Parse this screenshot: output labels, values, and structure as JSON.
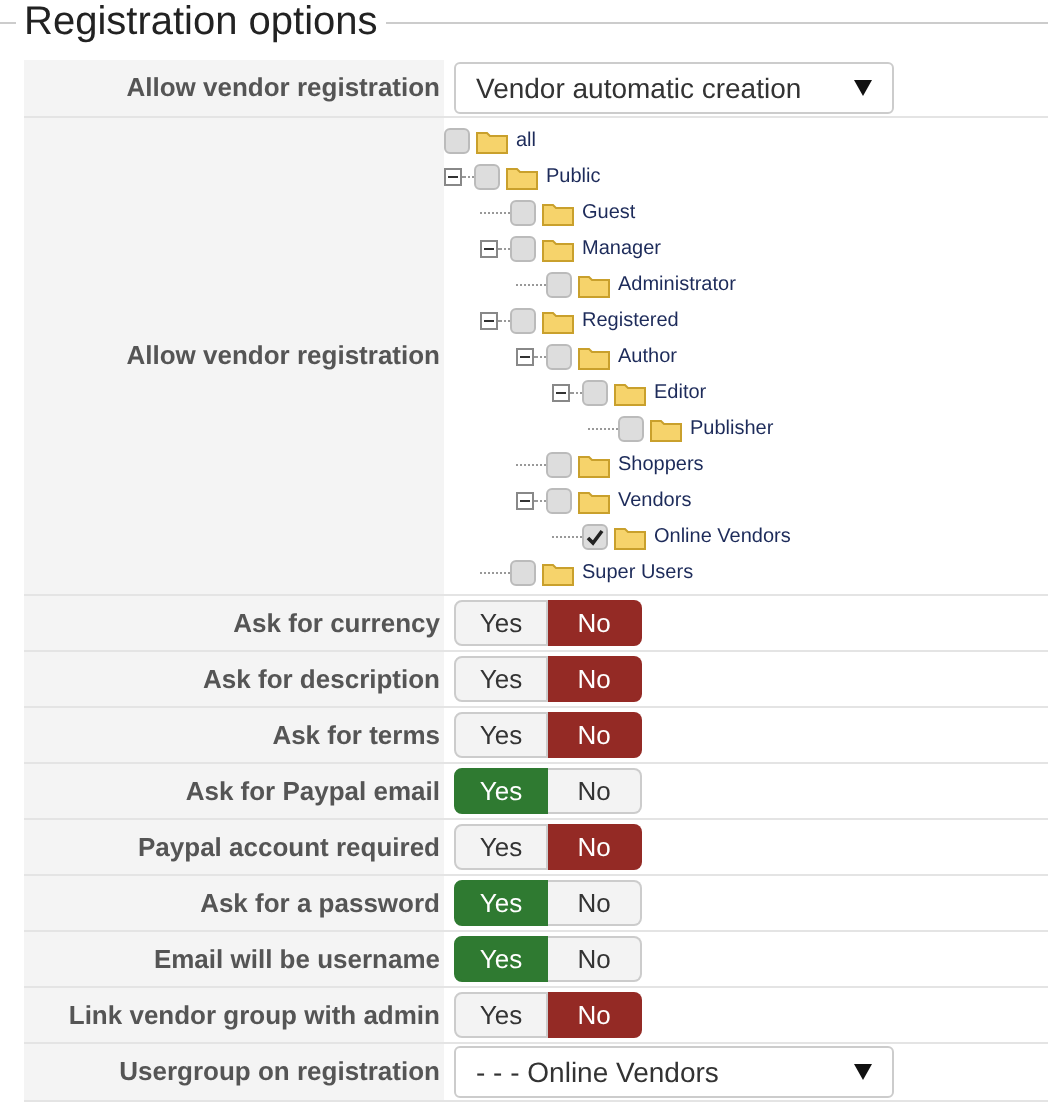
{
  "title": "Registration options",
  "rows": [
    {
      "kind": "select",
      "label": "Allow vendor registration",
      "value": "Vendor automatic creation"
    },
    {
      "kind": "tree",
      "label": "Allow vendor registration",
      "tree": [
        {
          "label": "all",
          "checked": false
        },
        {
          "label": "Public",
          "checked": false,
          "expanded": true,
          "children": [
            {
              "label": "Guest",
              "checked": false
            },
            {
              "label": "Manager",
              "checked": false,
              "expanded": true,
              "children": [
                {
                  "label": "Administrator",
                  "checked": false
                }
              ]
            },
            {
              "label": "Registered",
              "checked": false,
              "expanded": true,
              "children": [
                {
                  "label": "Author",
                  "checked": false,
                  "expanded": true,
                  "children": [
                    {
                      "label": "Editor",
                      "checked": false,
                      "expanded": true,
                      "children": [
                        {
                          "label": "Publisher",
                          "checked": false
                        }
                      ]
                    }
                  ]
                },
                {
                  "label": "Shoppers",
                  "checked": false
                },
                {
                  "label": "Vendors",
                  "checked": false,
                  "expanded": true,
                  "children": [
                    {
                      "label": "Online Vendors",
                      "checked": true
                    }
                  ]
                }
              ]
            },
            {
              "label": "Super Users",
              "checked": false
            }
          ]
        }
      ]
    },
    {
      "kind": "toggle",
      "label": "Ask for currency",
      "options": [
        {
          "label": "Yes",
          "selected": false
        },
        {
          "label": "No",
          "selected": true
        }
      ]
    },
    {
      "kind": "toggle",
      "label": "Ask for description",
      "options": [
        {
          "label": "Yes",
          "selected": false
        },
        {
          "label": "No",
          "selected": true
        }
      ]
    },
    {
      "kind": "toggle",
      "label": "Ask for terms",
      "options": [
        {
          "label": "Yes",
          "selected": false
        },
        {
          "label": "No",
          "selected": true
        }
      ]
    },
    {
      "kind": "toggle",
      "label": "Ask for Paypal email",
      "options": [
        {
          "label": "Yes",
          "selected": true
        },
        {
          "label": "No",
          "selected": false
        }
      ]
    },
    {
      "kind": "toggle",
      "label": "Paypal account required",
      "options": [
        {
          "label": "Yes",
          "selected": false
        },
        {
          "label": "No",
          "selected": true
        }
      ]
    },
    {
      "kind": "toggle",
      "label": "Ask for a password",
      "options": [
        {
          "label": "Yes",
          "selected": true
        },
        {
          "label": "No",
          "selected": false
        }
      ]
    },
    {
      "kind": "toggle",
      "label": "Email will be username",
      "options": [
        {
          "label": "Yes",
          "selected": true
        },
        {
          "label": "No",
          "selected": false
        }
      ]
    },
    {
      "kind": "toggle",
      "label": "Link vendor group with admin",
      "options": [
        {
          "label": "Yes",
          "selected": false
        },
        {
          "label": "No",
          "selected": true
        }
      ]
    },
    {
      "kind": "select",
      "label": "Usergroup on registration",
      "value": "- - - Online Vendors"
    }
  ]
}
